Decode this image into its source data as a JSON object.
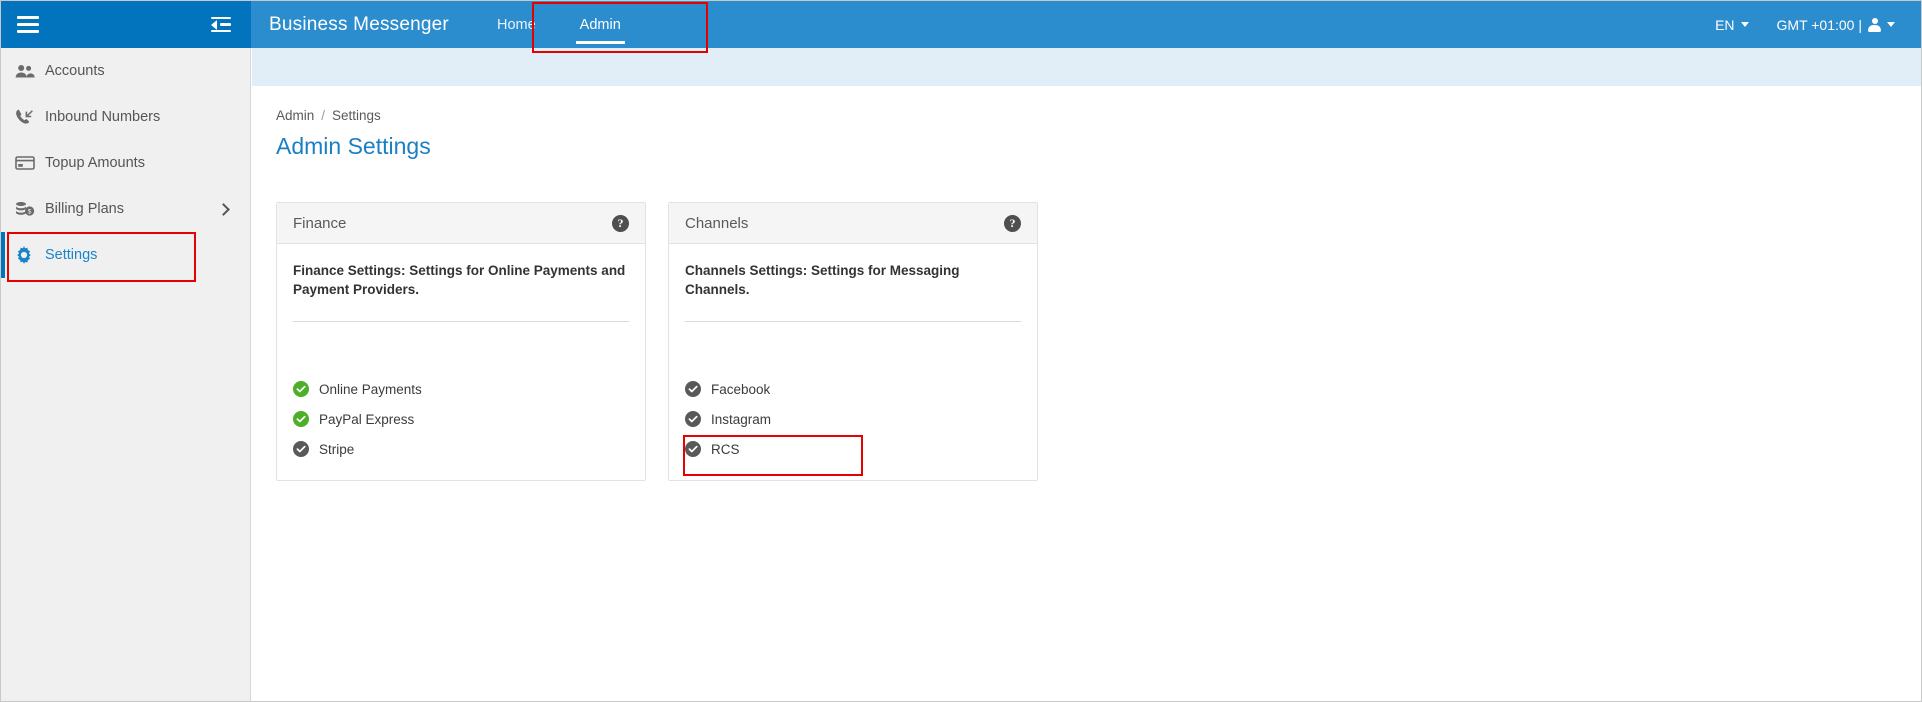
{
  "topbar": {
    "brand": "Business Messenger",
    "hamburger_icon": "hamburger-menu-icon",
    "collapse_icon": "sidebar-collapse-icon",
    "tabs": [
      {
        "label": "Home",
        "active": false
      },
      {
        "label": "Admin",
        "active": true
      }
    ],
    "language": "EN",
    "timezone_user": "GMT +01:00 |",
    "user_icon": "user-avatar-icon"
  },
  "sidebar": {
    "items": [
      {
        "label": "Accounts",
        "icon": "users-icon",
        "active": false,
        "expandable": false
      },
      {
        "label": "Inbound Numbers",
        "icon": "phone-incoming-icon",
        "active": false,
        "expandable": false
      },
      {
        "label": "Topup Amounts",
        "icon": "credit-card-icon",
        "active": false,
        "expandable": false
      },
      {
        "label": "Billing Plans",
        "icon": "money-stack-icon",
        "active": false,
        "expandable": true
      },
      {
        "label": "Settings",
        "icon": "gear-icon",
        "active": true,
        "expandable": false
      }
    ]
  },
  "main": {
    "breadcrumb": {
      "root": "Admin",
      "separator": "/",
      "current": "Settings"
    },
    "page_title": "Admin Settings",
    "cards": [
      {
        "title": "Finance",
        "help_icon": "help-circle-icon",
        "description": "Finance Settings: Settings for Online Payments and Payment Providers.",
        "options": [
          {
            "label": "Online Payments",
            "state": "on",
            "icon": "check-circle-icon"
          },
          {
            "label": "PayPal Express",
            "state": "on",
            "icon": "check-circle-icon"
          },
          {
            "label": "Stripe",
            "state": "off",
            "icon": "check-circle-icon"
          }
        ]
      },
      {
        "title": "Channels",
        "help_icon": "help-circle-icon",
        "description": "Channels Settings: Settings for Messaging Channels.",
        "options": [
          {
            "label": "Facebook",
            "state": "off",
            "icon": "check-circle-icon"
          },
          {
            "label": "Instagram",
            "state": "off",
            "icon": "check-circle-icon"
          },
          {
            "label": "RCS",
            "state": "off",
            "icon": "check-circle-icon"
          }
        ]
      }
    ]
  },
  "highlights": {
    "admin_tab": "admin-tab-highlight",
    "settings_item": "settings-sidebar-highlight",
    "facebook_option": "facebook-option-highlight"
  },
  "colors": {
    "nav_blue": "#2b8cce",
    "sidebar_head_blue": "#0273bd",
    "accent_blue": "#1b7fc4",
    "band_blue": "#e1eef7",
    "sidebar_gray": "#f0f0f0",
    "check_on_green": "#4caf26",
    "check_off_gray": "#595959",
    "highlight_red": "#e60000"
  }
}
